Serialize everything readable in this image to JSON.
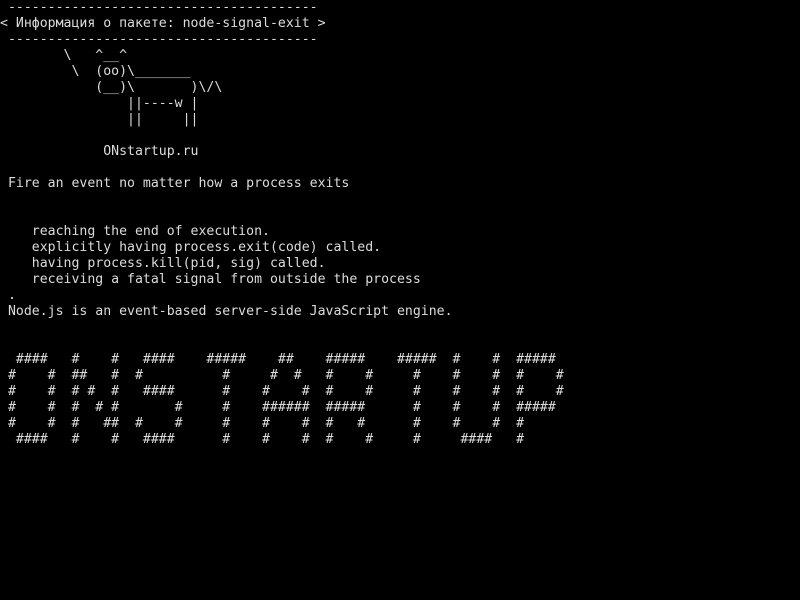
{
  "colors": {
    "background": "#000000",
    "foreground": "#dcdcdc"
  },
  "terminal": {
    "lines": [
      " ---------------------------------------",
      "< Информация о пакете: node-signal-exit >",
      " ---------------------------------------",
      "        \\   ^__^",
      "         \\  (oo)\\_______",
      "            (__)\\       )\\/\\",
      "                ||----w |",
      "                ||     ||",
      "",
      "             ONstartup.ru",
      "",
      " Fire an event no matter how a process exits",
      "",
      "",
      "    reaching the end of execution.",
      "    explicitly having process.exit(code) called.",
      "    having process.kill(pid, sig) called.",
      "    receiving a fatal signal from outside the process",
      " .",
      " Node.js is an event-based server-side JavaScript engine.",
      "",
      "",
      "  ####   #    #   ####    #####    ##    #####    #####  #    #  #####",
      " #    #  ##   #  #          #     #  #   #    #     #    #    #  #    #",
      " #    #  # #  #   ####      #    #    #  #    #     #    #    #  #    #",
      " #    #  #  # #       #     #    ######  #####      #    #    #  #####",
      " #    #  #   ##  #    #     #    #    #  #   #      #    #    #  #",
      "  ####   #    #   ####      #    #    #  #    #     #     ####   #"
    ]
  }
}
